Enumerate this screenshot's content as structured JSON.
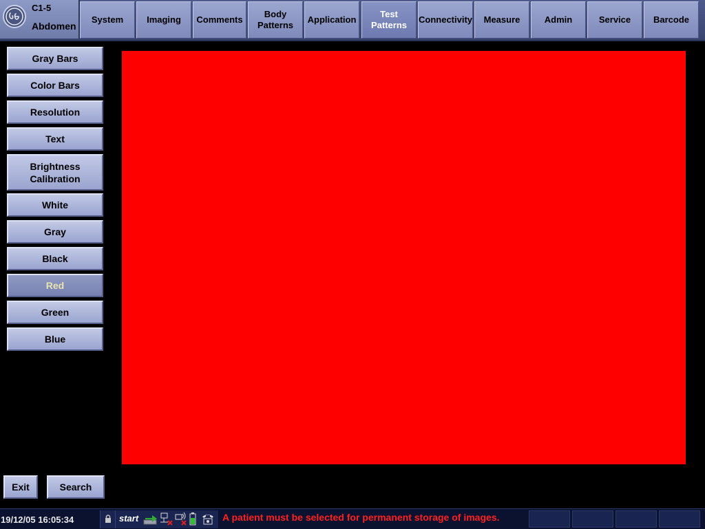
{
  "probe": {
    "model": "C1-5",
    "preset": "Abdomen"
  },
  "tabs": [
    {
      "label": "System"
    },
    {
      "label": "Imaging"
    },
    {
      "label": "Comments"
    },
    {
      "label": "Body\nPatterns"
    },
    {
      "label": "Application"
    },
    {
      "label": "Test\nPatterns",
      "active": true
    },
    {
      "label": "Connectivity"
    },
    {
      "label": "Measure"
    },
    {
      "label": "Admin"
    },
    {
      "label": "Service"
    },
    {
      "label": "Barcode"
    }
  ],
  "patterns": [
    {
      "label": "Gray Bars"
    },
    {
      "label": "Color Bars"
    },
    {
      "label": "Resolution"
    },
    {
      "label": "Text"
    },
    {
      "label": "Brightness\nCalibration"
    },
    {
      "label": "White"
    },
    {
      "label": "Gray"
    },
    {
      "label": "Black"
    },
    {
      "label": "Red",
      "selected": true
    },
    {
      "label": "Green"
    },
    {
      "label": "Blue"
    }
  ],
  "display": {
    "color": "#ff0000"
  },
  "bottom_buttons": {
    "exit": "Exit",
    "search": "Search"
  },
  "status": {
    "datetime": "19/12/05 16:05:34",
    "start_label": "start",
    "message": "A patient must be selected for permanent storage of images.",
    "message_color": "#ff2020"
  },
  "colors": {
    "tab_bg": "#8b96c6",
    "button_bg": "#b0b8dc",
    "selected_text": "#e8e3b0",
    "background": "#000000"
  },
  "icons": [
    "ge-logo-icon",
    "lock-icon",
    "transfer-icon",
    "network-disconnected-icon",
    "wireless-disconnected-icon",
    "battery-icon",
    "phone-icon"
  ]
}
